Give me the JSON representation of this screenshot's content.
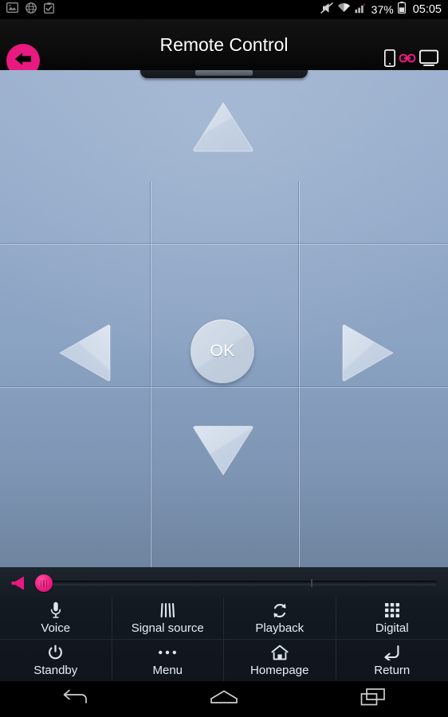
{
  "statusbar": {
    "left_icons": [
      "gallery-icon",
      "browser-globe-icon",
      "clipboard-check-icon"
    ],
    "right_icons": [
      "silent-mode-icon",
      "wifi-icon",
      "cell-signal-error-icon",
      "battery-icon"
    ],
    "battery_percent": "37%",
    "time": "05:05"
  },
  "titlebar": {
    "back_label": "back-arrow-icon",
    "title": "Remote Control",
    "connection": {
      "phone_icon": "phone-icon",
      "link_icon": "link-icon",
      "tv_icon": "tv-icon"
    }
  },
  "dpad": {
    "drawer_handle": "drawer-handle",
    "up": "up-arrow",
    "down": "down-arrow",
    "left": "left-arrow",
    "right": "right-arrow",
    "ok_label": "OK"
  },
  "volume": {
    "speaker_icon": "speaker-icon",
    "thumb_icon": "slider-thumb"
  },
  "functions": [
    {
      "label": "Voice",
      "icon": "microphone-icon"
    },
    {
      "label": "Signal source",
      "icon": "signal-source-icon"
    },
    {
      "label": "Playback",
      "icon": "playback-refresh-icon"
    },
    {
      "label": "Digital",
      "icon": "keypad-grid-icon"
    },
    {
      "label": "Standby",
      "icon": "power-icon"
    },
    {
      "label": "Menu",
      "icon": "more-dots-icon"
    },
    {
      "label": "Homepage",
      "icon": "home-icon"
    },
    {
      "label": "Return",
      "icon": "return-arrow-icon"
    }
  ],
  "navbar": {
    "back": "android-back-icon",
    "home": "android-home-icon",
    "recents": "android-recents-icon"
  },
  "colors": {
    "accent_pink": "#e8197f",
    "panel_blue_top": "#9bb0ce",
    "panel_blue_bottom": "#6e849f",
    "bar_dark": "#10151c",
    "text_light": "#e8edf4"
  }
}
